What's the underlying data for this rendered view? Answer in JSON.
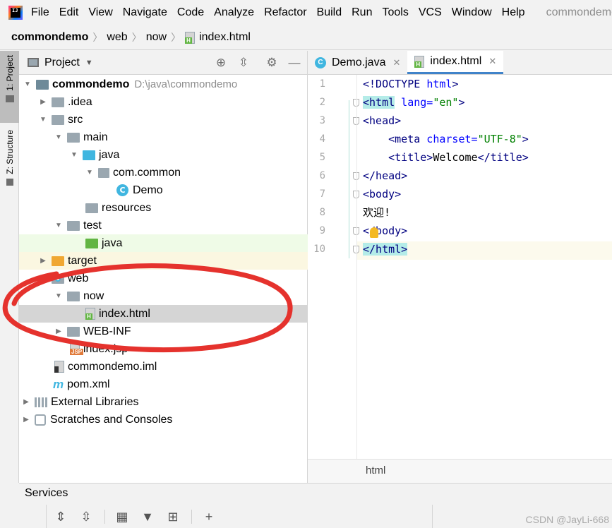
{
  "menubar": {
    "items": [
      "File",
      "Edit",
      "View",
      "Navigate",
      "Code",
      "Analyze",
      "Refactor",
      "Build",
      "Run",
      "Tools",
      "VCS",
      "Window",
      "Help"
    ],
    "window_title": "commondemo"
  },
  "breadcrumb": [
    "commondemo",
    "web",
    "now",
    "index.html"
  ],
  "left_strip": {
    "project_tab": "1: Project",
    "structure_tab": "Z: Structure"
  },
  "project_panel": {
    "title": "Project",
    "tree": [
      {
        "label": "commondemo",
        "path": "D:\\java\\commondemo"
      },
      {
        "label": ".idea"
      },
      {
        "label": "src"
      },
      {
        "label": "main"
      },
      {
        "label": "java"
      },
      {
        "label": "com.common"
      },
      {
        "label": "Demo"
      },
      {
        "label": "resources"
      },
      {
        "label": "test"
      },
      {
        "label": "java"
      },
      {
        "label": "target"
      },
      {
        "label": "web"
      },
      {
        "label": "now"
      },
      {
        "label": "index.html"
      },
      {
        "label": "WEB-INF"
      },
      {
        "label": "index.jsp"
      },
      {
        "label": "commondemo.iml"
      },
      {
        "label": "pom.xml"
      },
      {
        "label": "External Libraries"
      },
      {
        "label": "Scratches and Consoles"
      }
    ]
  },
  "editor": {
    "tabs": [
      {
        "label": "Demo.java"
      },
      {
        "label": "index.html"
      }
    ],
    "line_numbers": [
      "1",
      "2",
      "3",
      "4",
      "5",
      "6",
      "7",
      "8",
      "9",
      "10"
    ],
    "lines": [
      {
        "t1": "<!DOCTYPE ",
        "a1": "html",
        "t2": ">"
      },
      {
        "t1": "<html",
        "a1": " lang=",
        "v1": "\"en\"",
        "t2": ">"
      },
      {
        "t1": "<head>"
      },
      {
        "t1": "    <meta",
        "a1": " charset=",
        "v1": "\"UTF-8\"",
        "t2": ">"
      },
      {
        "t1": "    <title>",
        "text": "Welcome",
        "t2": "</title>"
      },
      {
        "t1": "</head>"
      },
      {
        "t1": "<body>"
      },
      {
        "text": "欢迎!"
      },
      {
        "t1": "</body>"
      },
      {
        "t1": "</html>"
      }
    ],
    "status": "html"
  },
  "services": {
    "title": "Services"
  },
  "watermark": "CSDN @JayLi-668",
  "colors": {
    "annotation": "#e5322d",
    "selection": "#d5d5d5",
    "tab_underline": "#4083c9"
  }
}
